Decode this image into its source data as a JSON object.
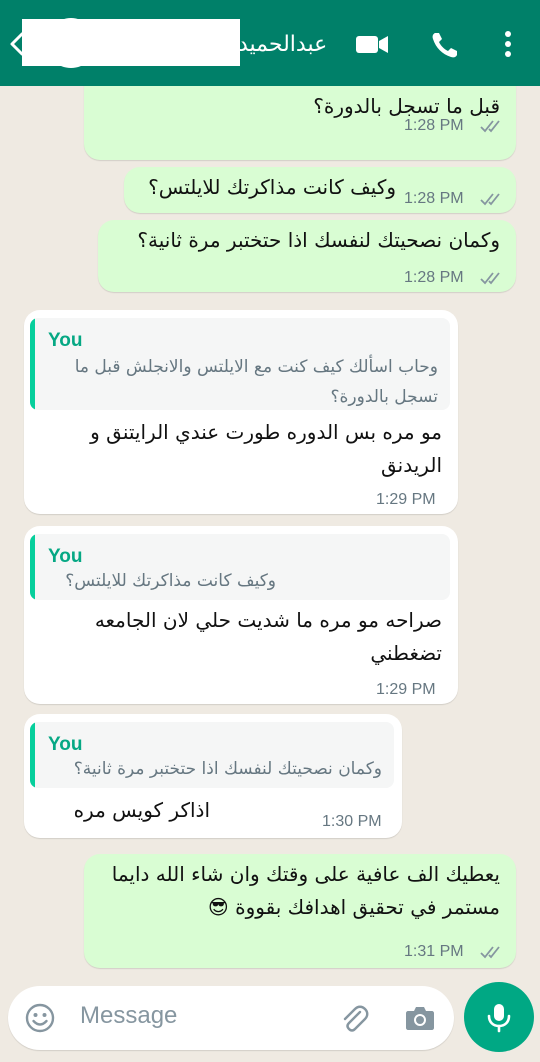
{
  "header": {
    "contact_name": "عبدالحميد",
    "icons": [
      "back-arrow-icon",
      "video-call-icon",
      "voice-call-icon",
      "more-options-icon"
    ]
  },
  "messages": [
    {
      "direction": "outgoing",
      "text": "قبل ما تسجل بالدورة؟",
      "time": "1:28 PM",
      "status": "read"
    },
    {
      "direction": "outgoing",
      "text": "وكيف كانت مذاكرتك للايلتس؟",
      "time": "1:28 PM",
      "status": "read"
    },
    {
      "direction": "outgoing",
      "text": "وكمان نصحيتك لنفسك اذا حتختبر مرة ثانية؟",
      "time": "1:28 PM",
      "status": "read"
    },
    {
      "direction": "incoming",
      "quote_author": "You",
      "quote_text": "وحاب اسألك كيف كنت مع الايلتس والانجلش قبل ما تسجل بالدورة؟",
      "text": "مو مره بس الدوره طورت عندي الرايتنق و الريدنق",
      "time": "1:29 PM"
    },
    {
      "direction": "incoming",
      "quote_author": "You",
      "quote_text": "وكيف كانت مذاكرتك للايلتس؟",
      "text": "صراحه مو مره ما شديت حلي لان الجامعه تضغطني",
      "time": "1:29 PM"
    },
    {
      "direction": "incoming",
      "quote_author": "You",
      "quote_text": "وكمان نصحيتك لنفسك اذا حتختبر مرة ثانية؟",
      "text": "اذاكر كويس مره",
      "time": "1:30 PM"
    },
    {
      "direction": "outgoing",
      "text": "يعطيك الف عافية على وقتك وان شاء الله دايما مستمر في تحقيق اهدافك بقووة 😎",
      "time": "1:31 PM",
      "status": "read"
    }
  ],
  "composer": {
    "placeholder": "Message",
    "icons": [
      "emoji-icon",
      "attach-icon",
      "camera-icon",
      "mic-icon"
    ]
  },
  "colors": {
    "header": "#008069",
    "outgoing_bubble": "#d9fdd3",
    "incoming_bubble": "#ffffff",
    "chat_background": "#efeae2",
    "quote_accent": "#06cf9c",
    "fab": "#00a884"
  }
}
